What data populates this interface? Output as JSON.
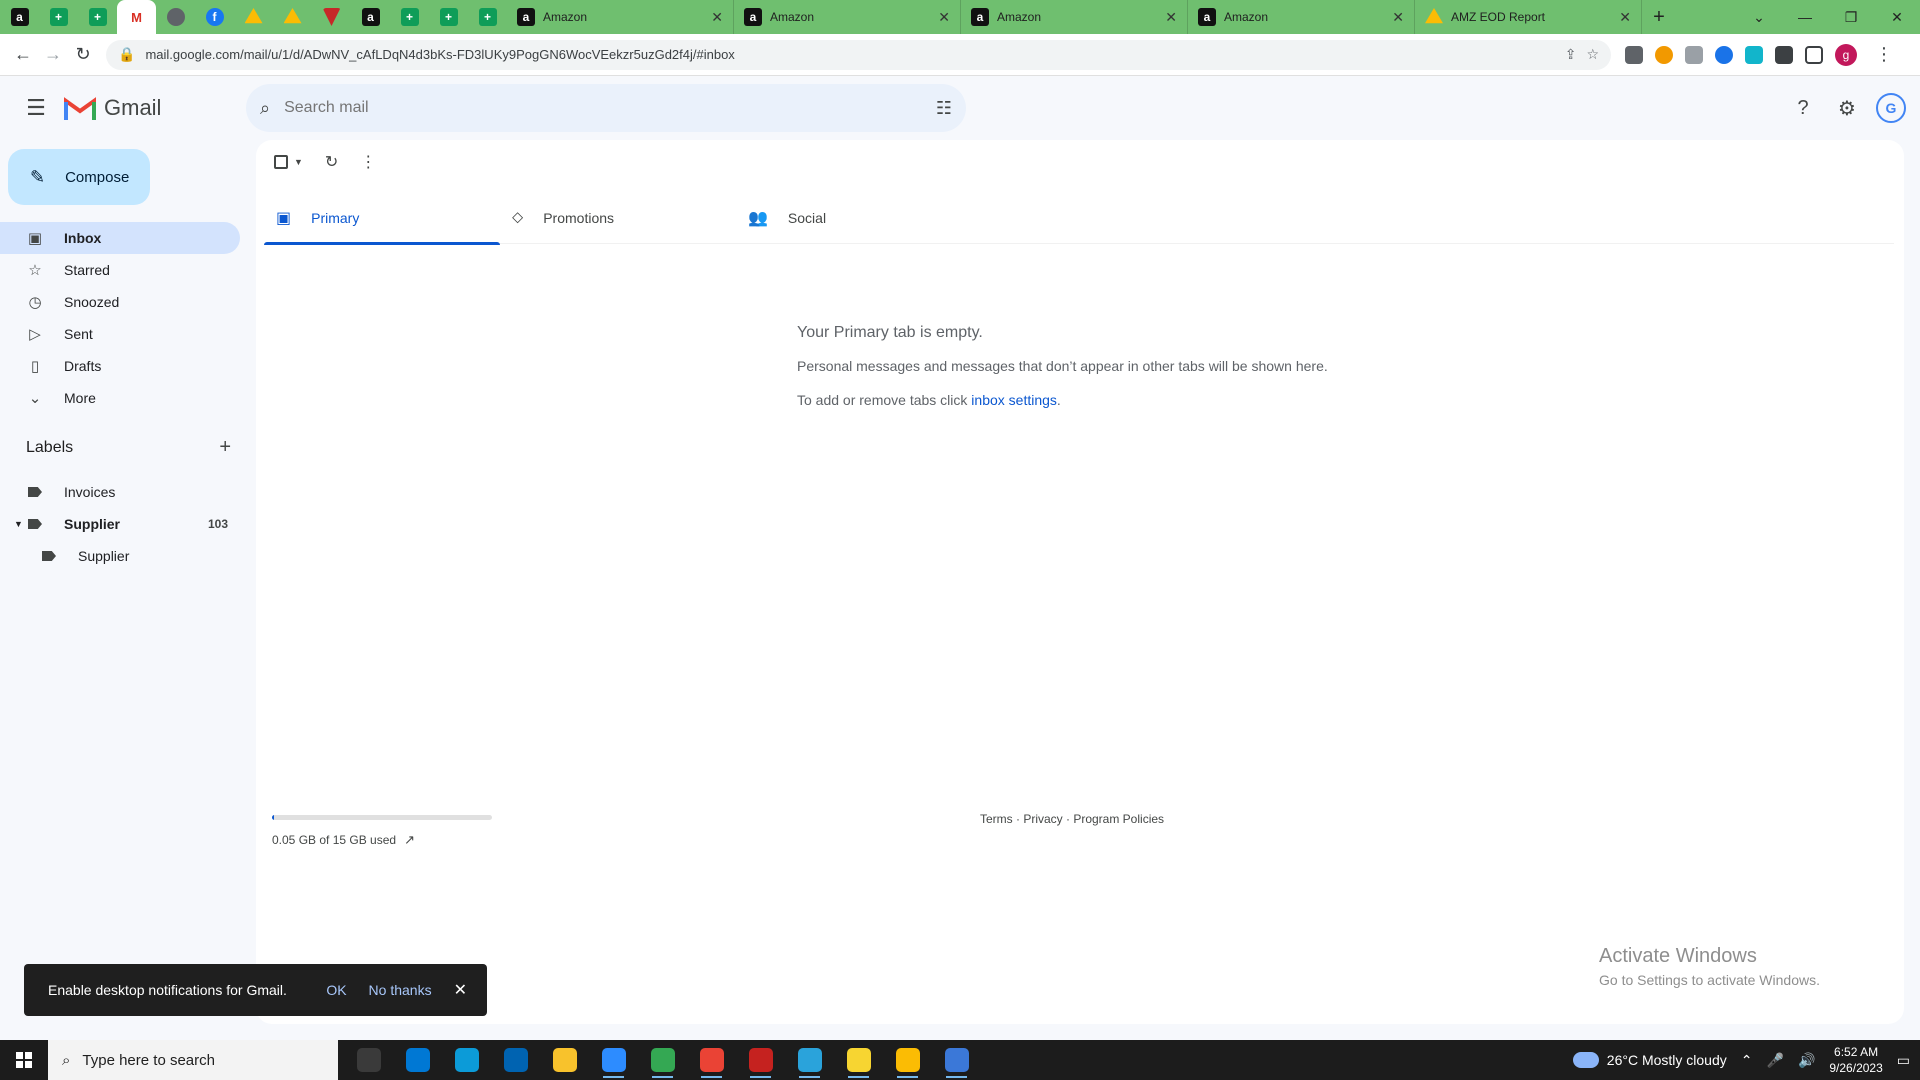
{
  "browser": {
    "pinned_tabs": [
      {
        "icon": "amazon-icon",
        "glyph": "a"
      },
      {
        "icon": "sheets-icon",
        "glyph": "+"
      },
      {
        "icon": "sheets-icon",
        "glyph": "+"
      },
      {
        "icon": "gmail-icon",
        "glyph": "M"
      },
      {
        "icon": "globe-icon",
        "glyph": ""
      },
      {
        "icon": "facebook-icon",
        "glyph": "f"
      },
      {
        "icon": "drive-icon",
        "glyph": ""
      },
      {
        "icon": "drive-icon",
        "glyph": ""
      },
      {
        "icon": "red-triangle-icon",
        "glyph": ""
      },
      {
        "icon": "amazon-icon",
        "glyph": "a"
      },
      {
        "icon": "sheets-icon",
        "glyph": "+"
      },
      {
        "icon": "sheets-icon",
        "glyph": "+"
      },
      {
        "icon": "sheets-icon",
        "glyph": "+"
      }
    ],
    "tabs": [
      {
        "title": "Amazon",
        "icon": "amazon-icon"
      },
      {
        "title": "Amazon",
        "icon": "amazon-icon"
      },
      {
        "title": "Amazon",
        "icon": "amazon-icon"
      },
      {
        "title": "Amazon",
        "icon": "amazon-icon"
      },
      {
        "title": "AMZ EOD Report",
        "icon": "drive-icon"
      }
    ],
    "url": "mail.google.com/mail/u/1/d/ADwNV_cAfLDqN4d3bKs-FD3lUKy9PogGN6WocVEekzr5uzGd2f4j/#inbox",
    "profile_initial": "g"
  },
  "gmail": {
    "logo_text": "Gmail",
    "search_placeholder": "Search mail",
    "compose_label": "Compose",
    "nav": [
      {
        "label": "Inbox",
        "icon": "inbox-icon",
        "glyph": "▣",
        "active": true
      },
      {
        "label": "Starred",
        "icon": "star-icon",
        "glyph": "☆"
      },
      {
        "label": "Snoozed",
        "icon": "clock-icon",
        "glyph": "◷"
      },
      {
        "label": "Sent",
        "icon": "send-icon",
        "glyph": "▷"
      },
      {
        "label": "Drafts",
        "icon": "draft-icon",
        "glyph": "▯"
      },
      {
        "label": "More",
        "icon": "chevron-down-icon",
        "glyph": "⌄"
      }
    ],
    "labels_heading": "Labels",
    "labels": [
      {
        "label": "Invoices",
        "count": ""
      },
      {
        "label": "Supplier",
        "count": "103"
      },
      {
        "label": "Supplier",
        "count": ""
      }
    ],
    "tabs": [
      {
        "label": "Primary",
        "icon": "inbox-icon",
        "glyph": "▣"
      },
      {
        "label": "Promotions",
        "icon": "tag-icon",
        "glyph": "⬦"
      },
      {
        "label": "Social",
        "icon": "people-icon",
        "glyph": "👥"
      }
    ],
    "empty": {
      "title": "Your Primary tab is empty.",
      "line1": "Personal messages and messages that don’t appear in other tabs will be shown here.",
      "line2_prefix": "To add or remove tabs click ",
      "line2_link": "inbox settings",
      "line2_suffix": "."
    },
    "storage": {
      "text": "0.05 GB of 15 GB used",
      "used_fraction": 0.0033
    },
    "footer": "Terms · Privacy · Program Policies",
    "activate_title": "Activate Windows",
    "activate_sub": "Go to Settings to activate Windows."
  },
  "snackbar": {
    "text": "Enable desktop notifications for Gmail.",
    "ok": "OK",
    "no_thanks": "No thanks"
  },
  "taskbar": {
    "search_placeholder": "Type here to search",
    "weather": "26°C  Mostly cloudy",
    "time": "6:52 AM",
    "date": "9/26/2023",
    "apps": [
      {
        "icon": "task-view-icon",
        "color": "#3a3a3a"
      },
      {
        "icon": "store-icon",
        "color": "#0078d4"
      },
      {
        "icon": "edge-icon",
        "color": "#0c9bd8"
      },
      {
        "icon": "mail-icon",
        "color": "#0063b1"
      },
      {
        "icon": "file-explorer-icon",
        "color": "#f8c22c"
      },
      {
        "icon": "zoom-icon",
        "color": "#2d8cff"
      },
      {
        "icon": "chrome-icon",
        "color": "#34a853"
      },
      {
        "icon": "chrome-icon",
        "color": "#ea4335"
      },
      {
        "icon": "chrome-icon",
        "color": "#c5221f"
      },
      {
        "icon": "telegram-icon",
        "color": "#2aa3db"
      },
      {
        "icon": "sticky-notes-icon",
        "color": "#f7d531"
      },
      {
        "icon": "chrome-icon",
        "color": "#fbbc04"
      },
      {
        "icon": "calculator-icon",
        "color": "#3b78d8"
      }
    ]
  }
}
